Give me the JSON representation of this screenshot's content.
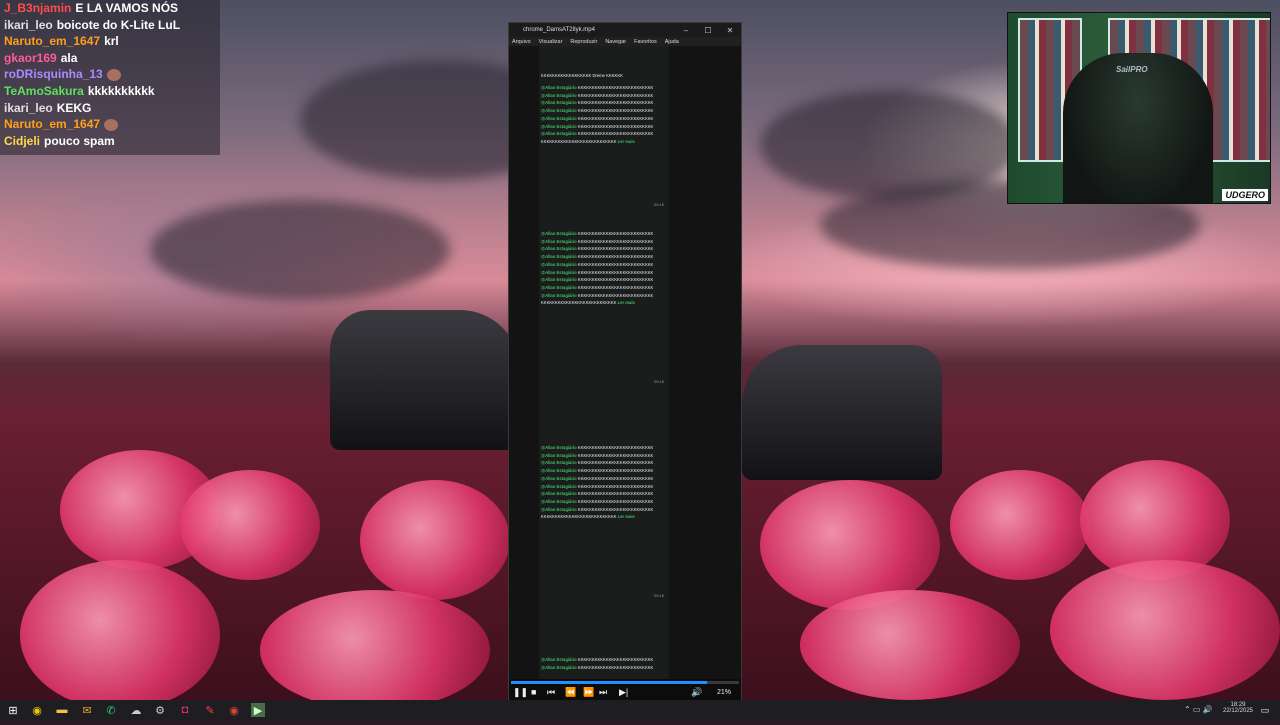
{
  "chat": {
    "lines": [
      {
        "user": "J_B3njamin",
        "color": "#ff4d4d",
        "message": "E LA VAMOS NÓS"
      },
      {
        "user": "ikari_leo",
        "color": "#e0e0e0",
        "message": "boicote do K-Lite LuL"
      },
      {
        "user": "Naruto_em_1647",
        "color": "#ff9f1a",
        "message": "krl"
      },
      {
        "user": "gkaor169",
        "color": "#ff5a9a",
        "message": "ala"
      },
      {
        "user": "roDRisquinha_13",
        "color": "#a98bff",
        "message": ""
      },
      {
        "user": "TeAmoSakura",
        "color": "#5fe05f",
        "message": "kkkkkkkkkk"
      },
      {
        "user": "ikari_leo",
        "color": "#e0e0e0",
        "message": "KEKG"
      },
      {
        "user": "Naruto_em_1647",
        "color": "#ff9f1a",
        "message": ""
      },
      {
        "user": "Cidjeli",
        "color": "#ffd84d",
        "message": "pouco spam"
      }
    ]
  },
  "player": {
    "title": "chrome_DamsAT2Ilyk.mp4",
    "menu": [
      "Arquivo",
      "Visualizar",
      "Reproduzir",
      "Navegar",
      "Favoritos",
      "Ajuda"
    ],
    "volume": "21%",
    "progress": 0.86,
    "video_chat": {
      "sender": "@Allan Estagiário",
      "spam": "KKKKKKKKKKKKKKKKKKKKKKKKKKK",
      "read_more": "Ler mais",
      "time": "09:15",
      "top_line": "KKKKKKKKKKKKKKKKKK Dreme KKKKKK"
    }
  },
  "webcam": {
    "badge": "UDGERO",
    "chair_brand": "SailPRO"
  },
  "taskbar": {
    "icons": [
      "windows-logo-icon",
      "chrome-icon",
      "file-explorer-icon",
      "mail-icon",
      "whatsapp-icon",
      "cloud-icon",
      "settings-icon",
      "instagram-icon",
      "tool-icon",
      "chrome-alt-icon",
      "media-player-icon"
    ],
    "time": "18:29",
    "date": "22/12/2025"
  }
}
